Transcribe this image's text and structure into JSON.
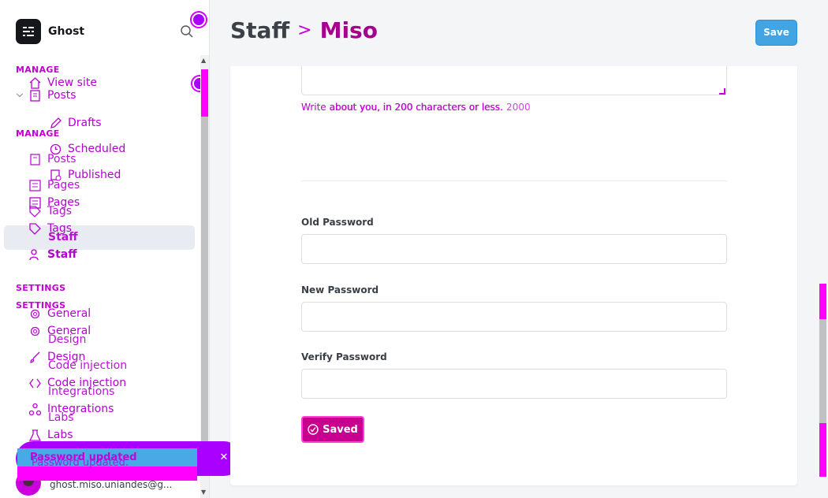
{
  "brand": {
    "name": "Ghost"
  },
  "sidebar": {
    "manage_label": "MANAGE",
    "settings_label": "SETTINGS",
    "view_site": "View site",
    "manage_items_a": [
      {
        "label": "Posts",
        "icon": "posts-icon"
      },
      {
        "label": "Drafts",
        "icon": "pencil-icon"
      },
      {
        "label": "Scheduled",
        "icon": "clock-icon"
      },
      {
        "label": "Published",
        "icon": "published-icon"
      }
    ],
    "manage_items_b": [
      {
        "label": "Posts",
        "icon": "posts-icon"
      },
      {
        "label": "Pages",
        "icon": "pages-icon"
      },
      {
        "label": "Tags",
        "icon": "tag-icon"
      },
      {
        "label": "Staff",
        "icon": "staff-icon"
      }
    ],
    "settings_items": [
      {
        "label": "General",
        "icon": "gear-icon"
      },
      {
        "label": "Design",
        "icon": "brush-icon"
      },
      {
        "label": "Code injection",
        "icon": "code-icon"
      },
      {
        "label": "Integrations",
        "icon": "integrations-icon"
      },
      {
        "label": "Labs",
        "icon": "flask-icon"
      }
    ]
  },
  "user": {
    "email": "ghost.miso.uniandes@g..."
  },
  "toast": {
    "message": "Password updated",
    "message_ghost": "Password updated."
  },
  "header": {
    "crumb_root": "Staff",
    "crumb_sep": ">",
    "crumb_current": "Miso",
    "save_label": "Save"
  },
  "form": {
    "bio_hint": "Write about you, in 200 characters or less.",
    "bio_hint_overlay": "about you, in 200 characters or less. 2000",
    "old_password_label": "Old Password",
    "new_password_label": "New Password",
    "verify_password_label": "Verify Password",
    "saved_label": "Saved"
  },
  "colors": {
    "accent_magenta": "#c400d4",
    "save_blue": "#42a4e3",
    "saved_button": "#c8008f"
  }
}
